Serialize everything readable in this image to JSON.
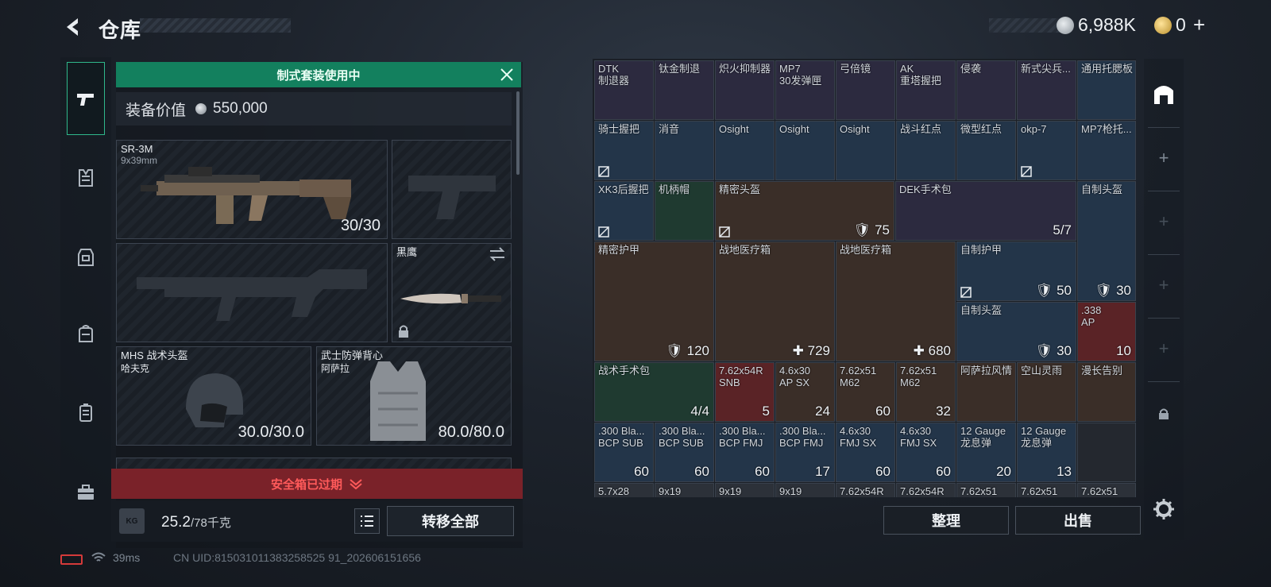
{
  "header": {
    "title": "仓库",
    "currency_silver": "6,988K",
    "currency_gold": "0"
  },
  "banner": {
    "text": "制式套装使用中"
  },
  "equip_value": {
    "label": "装备价值",
    "value": "550,000"
  },
  "slots": {
    "primary": {
      "name": "SR-3M",
      "sub": "9x39mm",
      "count": "30/30"
    },
    "melee": {
      "name": "黑鹰"
    },
    "helmet": {
      "name": "MHS 战术头盔",
      "sub": "哈夫克",
      "count": "30.0/30.0"
    },
    "armor": {
      "name": "武士防弹背心",
      "sub": "阿萨拉",
      "count": "80.0/80.0"
    }
  },
  "safe_box": {
    "text": "安全箱已过期"
  },
  "weight": {
    "current": "25.2",
    "max": "/78千克"
  },
  "buttons": {
    "transfer_all": "转移全部",
    "organize": "整理",
    "sell": "出售"
  },
  "status": {
    "ping": "39ms",
    "uid": "CN UID:815031011383258525 91_202606151656"
  },
  "inventory": {
    "row1": [
      {
        "name": "DTK\n制退器"
      },
      {
        "name": "钛金制退"
      },
      {
        "name": "炽火抑制器"
      },
      {
        "name": "MP7\n30发弹匣"
      },
      {
        "name": "弓倍镜"
      },
      {
        "name": "AK\n重塔握把"
      },
      {
        "name": "侵袭"
      },
      {
        "name": "新式尖兵..."
      },
      {
        "name": "通用托腮板"
      }
    ],
    "row2": [
      {
        "name": "骑士握把"
      },
      {
        "name": "消音"
      },
      {
        "name": "Osight"
      },
      {
        "name": "Osight"
      },
      {
        "name": "Osight"
      },
      {
        "name": "战斗红点"
      },
      {
        "name": "微型红点"
      },
      {
        "name": "okp-7"
      },
      {
        "name": "MP7枪托..."
      }
    ],
    "row3": [
      {
        "name": "XK3后握把"
      },
      {
        "name": "机柄帽"
      },
      {
        "name": "精密头盔",
        "prot": "75"
      },
      {
        "name": "DEK手术包",
        "count": "5/7"
      },
      {
        "name": "自制头盔"
      }
    ],
    "row4": [
      {
        "name": "精密护甲",
        "prot": "120"
      },
      {
        "name": "战地医疗箱",
        "heal": "729"
      },
      {
        "name": "战地医疗箱",
        "heal": "680"
      },
      {
        "name": "自制护甲",
        "prot": "50"
      },
      {
        "name": "",
        "prot": "30"
      }
    ],
    "row4b": [
      {
        "name": "自制头盔",
        "prot": "30"
      },
      {
        "name": ".338\nAP",
        "count": "10"
      }
    ],
    "row5": [
      {
        "name": "战术手术包",
        "count": "4/4"
      },
      {
        "name": "7.62x54R\nSNB",
        "count": "5"
      },
      {
        "name": "4.6x30\nAP SX",
        "count": "24"
      },
      {
        "name": "7.62x51\nM62",
        "count": "60"
      },
      {
        "name": "7.62x51\nM62",
        "count": "32"
      },
      {
        "name": "阿萨拉风情"
      },
      {
        "name": "空山灵雨"
      },
      {
        "name": "漫长告别"
      }
    ],
    "row6": [
      {
        "name": ".300 Bla...\nBCP SUB",
        "count": "60"
      },
      {
        "name": ".300 Bla...\nBCP SUB",
        "count": "60"
      },
      {
        "name": ".300 Bla...\nBCP FMJ",
        "count": "60"
      },
      {
        "name": ".300 Bla...\nBCP FMJ",
        "count": "17"
      },
      {
        "name": "4.6x30\nFMJ SX",
        "count": "60"
      },
      {
        "name": "4.6x30\nFMJ SX",
        "count": "60"
      },
      {
        "name": "12 Gauge\n龙息弹",
        "count": "20"
      },
      {
        "name": "12 Gauge\n龙息弹",
        "count": "13"
      }
    ],
    "row7": [
      {
        "name": "5.7x28"
      },
      {
        "name": "9x19"
      },
      {
        "name": "9x19"
      },
      {
        "name": "9x19"
      },
      {
        "name": "7.62x54R"
      },
      {
        "name": "7.62x54R"
      },
      {
        "name": "7.62x51"
      },
      {
        "name": "7.62x51"
      },
      {
        "name": "7.62x51"
      }
    ]
  }
}
